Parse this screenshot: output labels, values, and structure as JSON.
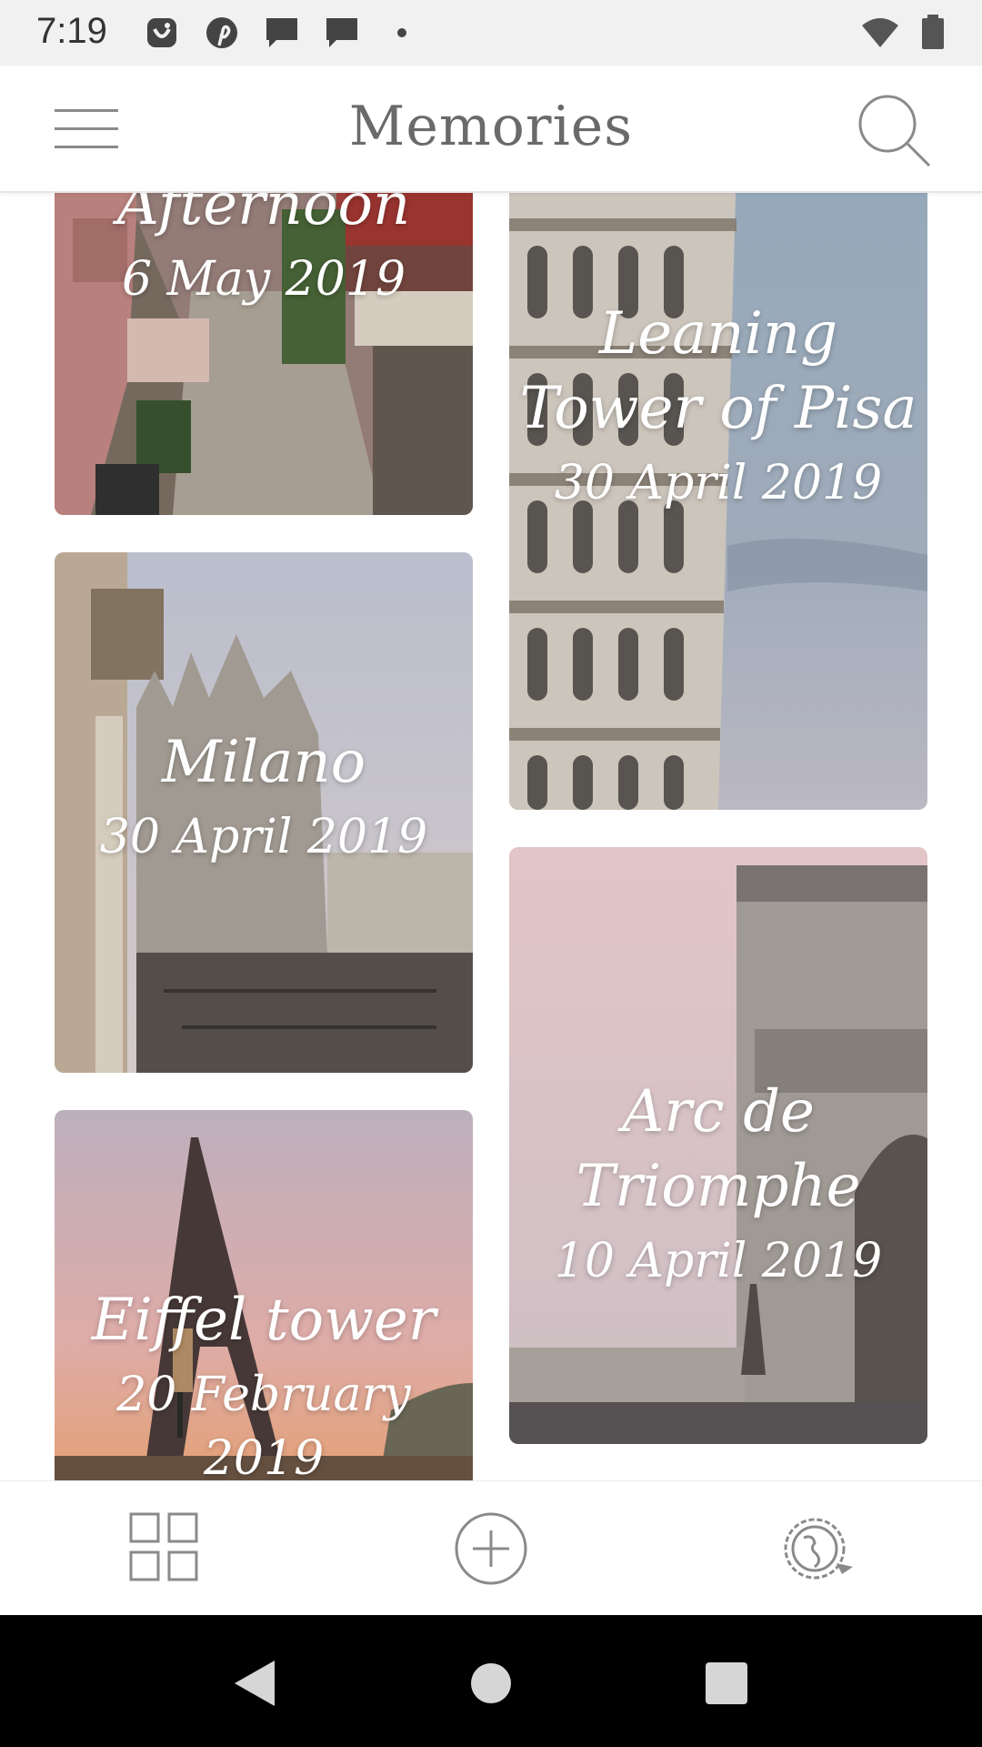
{
  "status_bar": {
    "time": "7:19",
    "icons": [
      "app-badge-icon",
      "pinterest-icon",
      "message-icon",
      "message-icon",
      "dot-icon",
      "wifi-icon",
      "battery-icon"
    ]
  },
  "app_bar": {
    "title": "Memories",
    "menu_icon": "menu-icon",
    "search_icon": "search-icon"
  },
  "memories": [
    {
      "title": "Afternoon",
      "date": "6 May 2019"
    },
    {
      "title": "Leaning Tower of Pisa",
      "date": "30 April 2019"
    },
    {
      "title": "Milano",
      "date": "30 April 2019"
    },
    {
      "title": "Arc de Triomphe",
      "date": "10 April 2019"
    },
    {
      "title": "Eiffel tower",
      "date": "20 February 2019"
    }
  ],
  "bottom_nav": {
    "items": [
      "grid-icon",
      "add-circle-icon",
      "globe-travel-icon"
    ]
  },
  "system_nav": [
    "back-icon",
    "home-icon",
    "recents-icon"
  ],
  "colors": {
    "title": "#6a6a6a",
    "icon_gray": "#8a8a8a",
    "overlay_text": "#ffffff"
  }
}
